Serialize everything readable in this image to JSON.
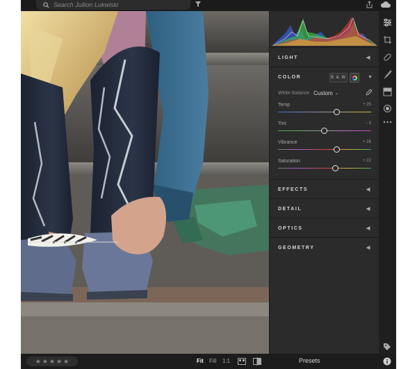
{
  "search": {
    "placeholder": "Search Jullion Lukwiski"
  },
  "edit_panel": {
    "sections": [
      {
        "label": "LIGHT"
      },
      {
        "label": "COLOR"
      },
      {
        "label": "EFFECTS"
      },
      {
        "label": "DETAIL"
      },
      {
        "label": "OPTICS"
      },
      {
        "label": "GEOMETRY"
      }
    ],
    "color": {
      "bw_label": "B & W",
      "white_balance_label": "White Balance",
      "white_balance_value": "Custom",
      "sliders": [
        {
          "label": "Temp",
          "value": "+ 25",
          "position": 0.63
        },
        {
          "label": "Tint",
          "value": "− 3",
          "position": 0.49
        },
        {
          "label": "Vibrance",
          "value": "+ 26",
          "position": 0.63
        },
        {
          "label": "Saturation",
          "value": "+ 22",
          "position": 0.61
        }
      ]
    }
  },
  "bottom_bar": {
    "rating_stars": [
      "★",
      "★",
      "★",
      "★",
      "★"
    ],
    "zoom_fit": "Fit",
    "zoom_fill": "Fill",
    "zoom_1to1": "1:1",
    "presets_label": "Presets"
  },
  "icons": {
    "top": [
      "search-icon",
      "filter-icon",
      "share-icon",
      "cloud-icon"
    ],
    "right_toolbar": [
      "edit-sliders-icon",
      "crop-icon",
      "healing-brush-icon",
      "brush-icon",
      "linear-gradient-icon",
      "radial-gradient-icon",
      "more-icon",
      "tag-icon",
      "info-icon"
    ]
  },
  "colors": {
    "accent_track_temp_start": "#3b6fd8",
    "accent_track_temp_end": "#e2b93b",
    "accent_track_tint_start": "#3fae4a",
    "accent_track_tint_end": "#c93fc9"
  }
}
